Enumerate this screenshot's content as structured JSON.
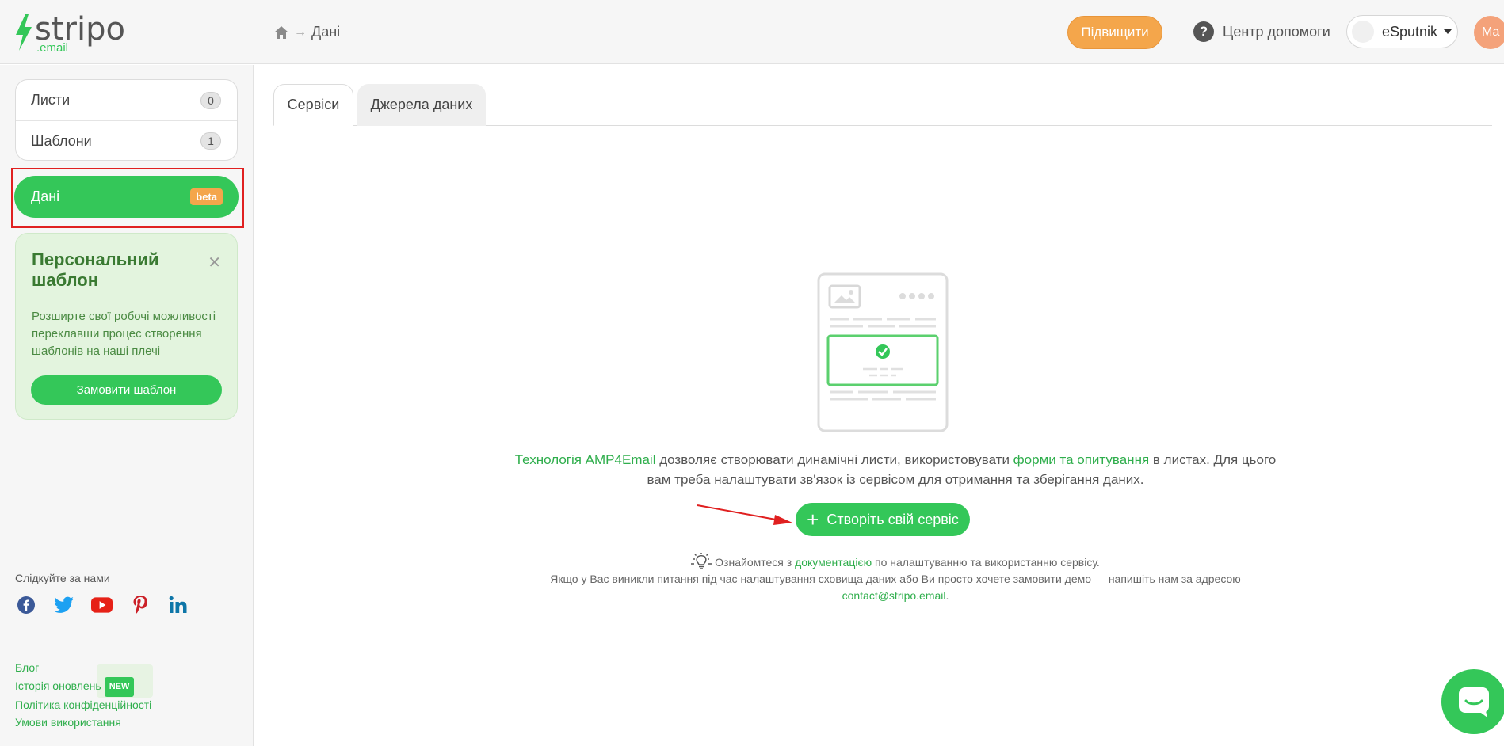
{
  "header": {
    "logo_word": "stripo",
    "logo_sub": ".email",
    "breadcrumb": {
      "current": "Дані"
    },
    "upgrade_label": "Підвищити",
    "help_label": "Центр допомоги",
    "account_label": "eSputnik",
    "user_initials": "Ма"
  },
  "sidebar": {
    "items": [
      {
        "label": "Листи",
        "count": "0"
      },
      {
        "label": "Шаблони",
        "count": "1"
      }
    ],
    "active": {
      "label": "Дані",
      "badge": "beta"
    },
    "promo": {
      "title": "Персональний шаблон",
      "text": "Розширте свої робочі можливості переклавши процес створення шаблонів на наші плечі",
      "button": "Замовити шаблон"
    },
    "follow_label": "Слідкуйте за нами",
    "links": {
      "blog": "Блог",
      "updates": "Історія оновлень",
      "updates_badge": "NEW",
      "privacy": "Політика конфіденційності",
      "terms": "Умови використання"
    }
  },
  "main": {
    "tabs": [
      {
        "label": "Сервіси"
      },
      {
        "label": "Джерела даних"
      }
    ],
    "description": {
      "link1": "Технологія AMP4Email",
      "part1": " дозволяє створювати динамічні листи, використовувати ",
      "link2": "форми та опитування",
      "part2": " в листах. Для цього вам треба налаштувати зв'язок із сервісом для отримання та зберігання даних."
    },
    "create_button": "Створіть свій сервіс",
    "notes": {
      "pre": "Ознайомтеся з ",
      "link": "документацією",
      "post": " по налаштуванню та використанню сервісу.",
      "line2": "Якщо у Вас виникли питання під час налаштування сховища даних або Ви просто хочете замовити демо — напишіть нам за адресою ",
      "email": "contact@stripo.email",
      "end": "."
    }
  },
  "colors": {
    "brand_green": "#34c759",
    "accent_orange": "#f4a64b",
    "highlight_red": "#e02020"
  }
}
